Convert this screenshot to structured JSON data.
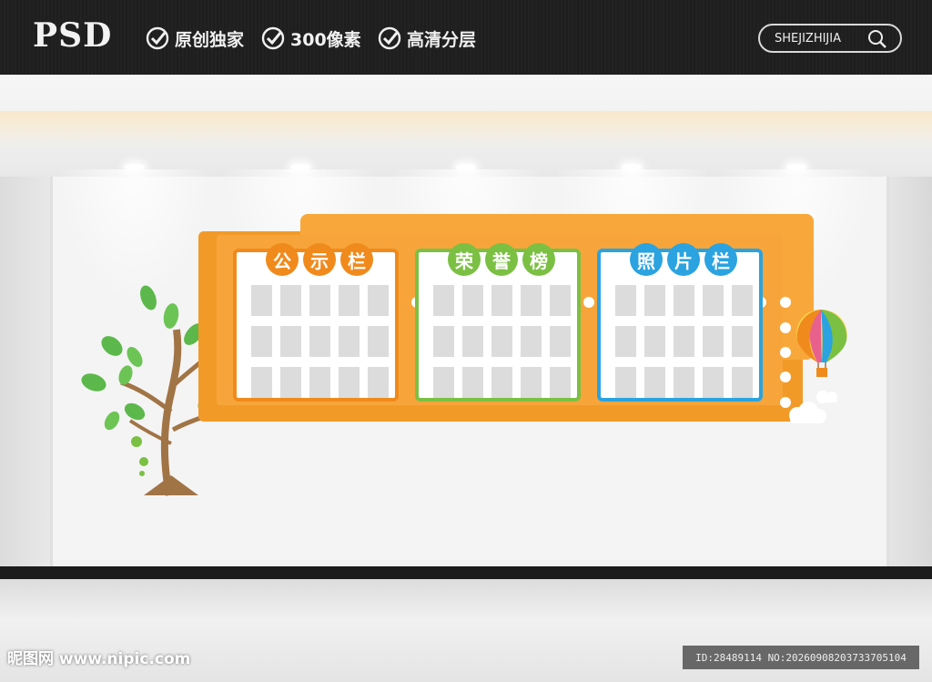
{
  "header": {
    "logo": "PSD",
    "features": [
      "原创独家",
      "300像素",
      "高清分层"
    ],
    "search_text": "SHEJIZHIJIA"
  },
  "board": {
    "sections": [
      {
        "title": [
          "公",
          "示",
          "栏"
        ],
        "color": "#f08a1c"
      },
      {
        "title": [
          "荣",
          "誉",
          "榜"
        ],
        "color": "#7bc043"
      },
      {
        "title": [
          "照",
          "片",
          "栏"
        ],
        "color": "#2aa3e0"
      }
    ]
  },
  "footer": {
    "watermark": "昵图网 www.nipic.com",
    "id_text": "ID:28489114 NO:20260908203733705104"
  },
  "colors": {
    "orange": "#f7a53a",
    "green": "#7bc043",
    "blue": "#2aa3e0"
  }
}
